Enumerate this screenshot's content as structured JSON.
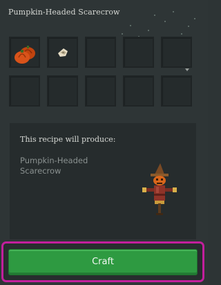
{
  "window": {
    "title": "Pumpkin-Headed Scarecrow"
  },
  "ingredients": [
    {
      "icon": "pumpkins-icon"
    },
    {
      "icon": "scrap-paper-icon"
    },
    {
      "icon": ""
    },
    {
      "icon": ""
    },
    {
      "icon": ""
    },
    {
      "icon": ""
    },
    {
      "icon": ""
    },
    {
      "icon": ""
    },
    {
      "icon": ""
    },
    {
      "icon": ""
    }
  ],
  "recipe": {
    "heading": "This recipe will produce:",
    "product_name": "Pumpkin-Headed Scarecrow",
    "product_icon": "scarecrow-icon"
  },
  "craft_button": {
    "label": "Craft",
    "color": "#2e9a41",
    "highlight_color": "#c21f9c"
  }
}
